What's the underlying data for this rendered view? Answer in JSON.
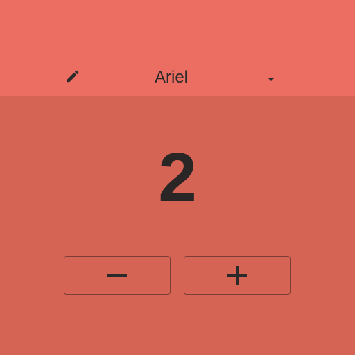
{
  "header": {
    "edit_icon": "pencil-icon",
    "player_name": "Ariel",
    "dropdown_icon": "caret-down-icon"
  },
  "counter": {
    "value": "2"
  },
  "controls": {
    "decrement_icon": "minus-icon",
    "increment_icon": "plus-icon"
  },
  "colors": {
    "header_background": "#ec6d62",
    "body_background": "#d56455",
    "text": "#2a2a2a",
    "button_border": "#7b3d36"
  }
}
